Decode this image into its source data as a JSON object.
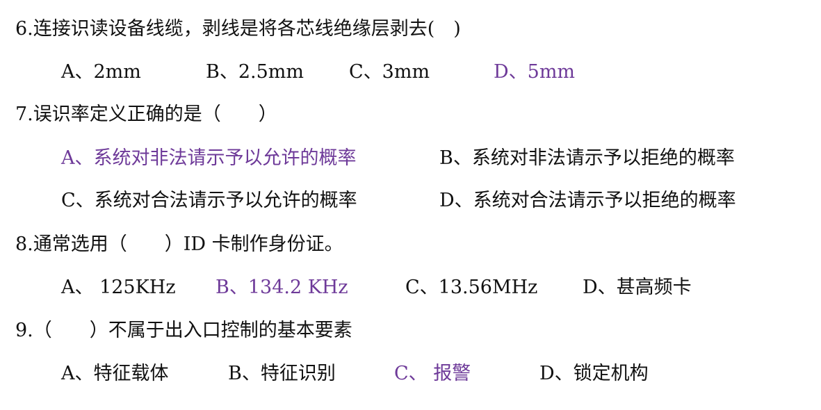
{
  "colors": {
    "text": "#111111",
    "highlight": "#6e3a99"
  },
  "questions": [
    {
      "stem": "6.连接识读设备线缆，剥线是将各芯线绝缘层剥去(　)",
      "options": [
        {
          "text": "A、2mm",
          "highlighted": false
        },
        {
          "text": "B、2.5mm",
          "highlighted": false
        },
        {
          "text": "C、3mm",
          "highlighted": false
        },
        {
          "text": "D、5mm",
          "highlighted": true
        }
      ]
    },
    {
      "stem": "7.误识率定义正确的是（　　）",
      "options": [
        {
          "text": "A、系统对非法请示予以允许的概率",
          "highlighted": true
        },
        {
          "text": "B、系统对非法请示予以拒绝的概率",
          "highlighted": false
        },
        {
          "text": "C、系统对合法请示予以允许的概率",
          "highlighted": false
        },
        {
          "text": "D、系统对合法请示予以拒绝的概率",
          "highlighted": false
        }
      ]
    },
    {
      "stem": "8.通常选用（　　）ID 卡制作身份证。",
      "options": [
        {
          "text": "A、 125KHz",
          "highlighted": false
        },
        {
          "text": "B、134.2 KHz",
          "highlighted": true
        },
        {
          "text": "C、13.56MHz",
          "highlighted": false
        },
        {
          "text": "D、甚高频卡",
          "highlighted": false
        }
      ]
    },
    {
      "stem": "9.（　　）不属于出入口控制的基本要素",
      "options": [
        {
          "text": "A、特征载体",
          "highlighted": false
        },
        {
          "text": "B、特征识别",
          "highlighted": false
        },
        {
          "text": "C、 报警",
          "highlighted": true
        },
        {
          "text": "D、锁定机构",
          "highlighted": false
        }
      ]
    }
  ]
}
